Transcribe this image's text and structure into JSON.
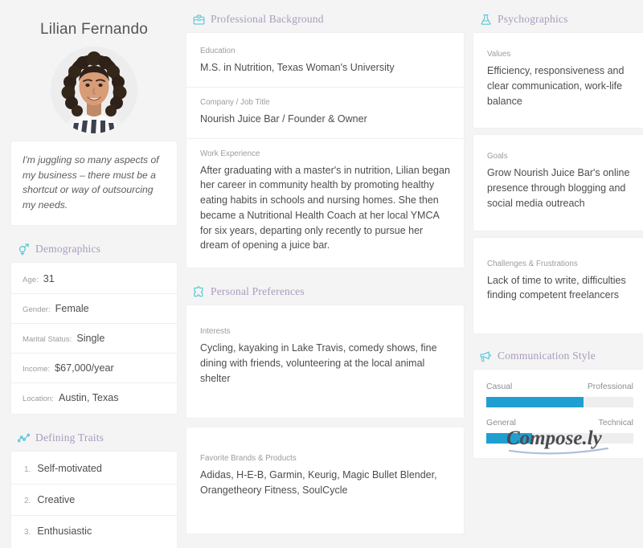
{
  "persona": {
    "name": "Lilian Fernando",
    "avatar_icon": "portrait-photo",
    "quote": "I'm juggling so many aspects of my business – there must be a shortcut or way of outsourcing my needs."
  },
  "demographics": {
    "heading": "Demographics",
    "icon": "gender-symbols-icon",
    "rows": [
      {
        "label": "Age:",
        "value": "31"
      },
      {
        "label": "Gender:",
        "value": "Female"
      },
      {
        "label": "Marital Status:",
        "value": "Single"
      },
      {
        "label": "Income:",
        "value": "$67,000/year"
      },
      {
        "label": "Location:",
        "value": "Austin, Texas"
      }
    ]
  },
  "defining_traits": {
    "heading": "Defining Traits",
    "icon": "network-graph-icon",
    "items": [
      {
        "num": "1.",
        "text": "Self-motivated"
      },
      {
        "num": "2.",
        "text": "Creative"
      },
      {
        "num": "3.",
        "text": "Enthusiastic"
      }
    ]
  },
  "professional_background": {
    "heading": "Professional Background",
    "icon": "briefcase-icon",
    "fields": [
      {
        "label": "Education",
        "value": "M.S. in Nutrition, Texas Woman's University"
      },
      {
        "label": "Company / Job Title",
        "value": "Nourish Juice Bar / Founder & Owner"
      },
      {
        "label": "Work Experience",
        "value": "After graduating with a master's in nutrition, Lilian began her career in community health by promoting healthy eating habits in schools and nursing homes. She then became a Nutritional Health Coach at her local YMCA for six years, departing only recently to pursue her dream of opening a juice bar."
      }
    ]
  },
  "personal_preferences": {
    "heading": "Personal Preferences",
    "icon": "puzzle-piece-icon",
    "interests": {
      "label": "Interests",
      "value": "Cycling, kayaking in Lake Travis, comedy shows, fine dining with friends, volunteering at the local animal shelter"
    },
    "brands": {
      "label": "Favorite Brands & Products",
      "value": "Adidas, H-E-B, Garmin, Keurig, Magic Bullet Blender, Orangetheory Fitness, SoulCycle"
    }
  },
  "psychographics": {
    "heading": "Psychographics",
    "icon": "flask-icon",
    "values_block": {
      "label": "Values",
      "value": "Efficiency, responsiveness and clear communication, work-life balance"
    },
    "goals_block": {
      "label": "Goals",
      "value": "Grow Nourish Juice Bar's online presence through blogging and social media outreach"
    },
    "challenges_block": {
      "label": "Challenges & Frustrations",
      "value": "Lack of time to write, difficulties finding competent freelancers"
    }
  },
  "communication_style": {
    "heading": "Communication Style",
    "icon": "megaphone-icon",
    "fill_color": "#1f9fd1",
    "sliders": [
      {
        "left_label": "Casual",
        "right_label": "Professional",
        "fill_percent": 66
      },
      {
        "left_label": "General",
        "right_label": "Technical",
        "fill_percent": 31
      }
    ]
  },
  "branding": {
    "logo_text": "Compose.ly"
  },
  "theme": {
    "page_background": "#f4f4f4",
    "card_background": "#ffffff",
    "heading_color": "#a99bbd",
    "icon_color": "#57c6d8",
    "body_text": "#4d4c51",
    "label_text": "#9c9ba0"
  }
}
